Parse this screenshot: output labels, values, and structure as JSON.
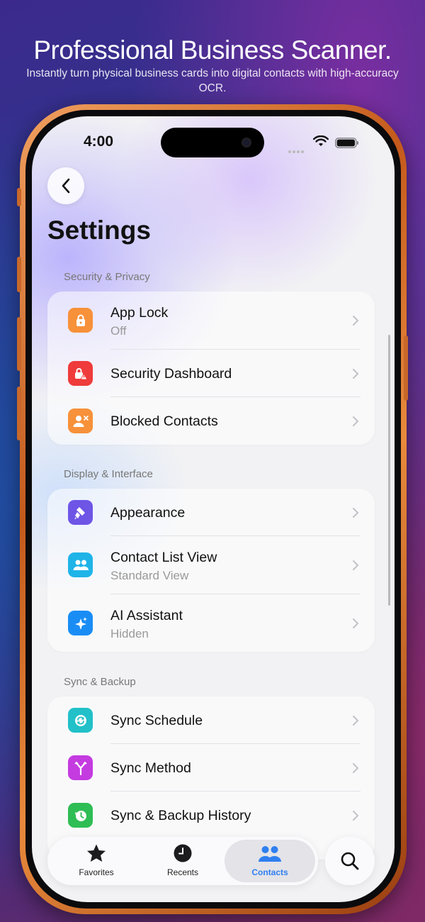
{
  "promo": {
    "headline": "Professional Business Scanner.",
    "subline": "Instantly turn physical business cards into digital contacts with high-accuracy OCR."
  },
  "status_bar": {
    "time": "4:00"
  },
  "header": {
    "title": "Settings"
  },
  "sections": [
    {
      "label": "Security & Privacy",
      "items": [
        {
          "label": "App Lock",
          "sub": "Off",
          "icon": "lock-icon",
          "color": "#f7913a"
        },
        {
          "label": "Security Dashboard",
          "sub": "",
          "icon": "security-alert-icon",
          "color": "#ef3b3b"
        },
        {
          "label": "Blocked Contacts",
          "sub": "",
          "icon": "blocked-contact-icon",
          "color": "#f7913a"
        }
      ]
    },
    {
      "label": "Display & Interface",
      "items": [
        {
          "label": "Appearance",
          "sub": "",
          "icon": "paintbrush-icon",
          "color": "#6e55e6"
        },
        {
          "label": "Contact List View",
          "sub": "Standard View",
          "icon": "people-icon",
          "color": "#1fb4e8"
        },
        {
          "label": "AI Assistant",
          "sub": "Hidden",
          "icon": "sparkles-icon",
          "color": "#1a8df5"
        }
      ]
    },
    {
      "label": "Sync & Backup",
      "items": [
        {
          "label": "Sync Schedule",
          "sub": "",
          "icon": "sync-icon",
          "color": "#22c0c8"
        },
        {
          "label": "Sync Method",
          "sub": "",
          "icon": "merge-icon",
          "color": "#c43be0"
        },
        {
          "label": "Sync & Backup History",
          "sub": "",
          "icon": "history-icon",
          "color": "#2fbd55"
        }
      ]
    }
  ],
  "tabbar": {
    "tabs": [
      {
        "label": "Favorites",
        "icon": "star-icon",
        "active": false
      },
      {
        "label": "Recents",
        "icon": "clock-icon",
        "active": false
      },
      {
        "label": "Contacts",
        "icon": "contacts-icon",
        "active": true
      }
    ],
    "search_icon": "search-icon"
  },
  "colors": {
    "accent": "#2f7ff0"
  }
}
